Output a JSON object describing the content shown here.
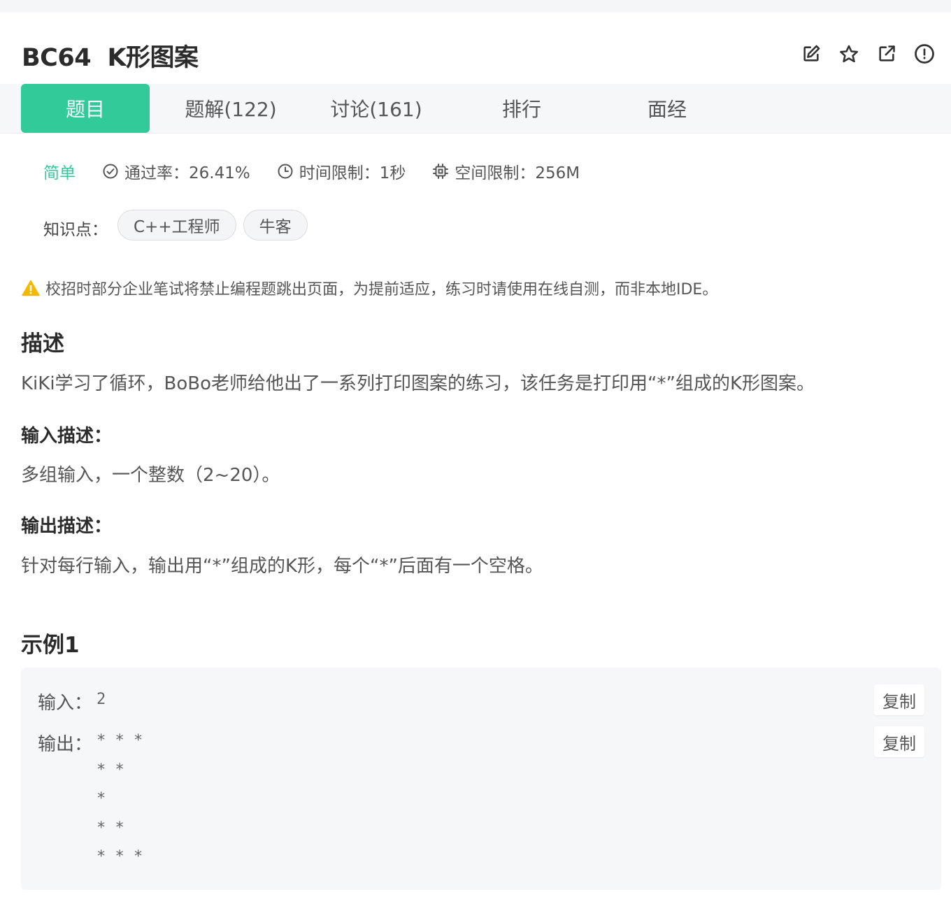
{
  "problem": {
    "title": "BC64  K形图案"
  },
  "tabs": [
    {
      "label": "题目",
      "active": true
    },
    {
      "label": "题解(122)",
      "active": false
    },
    {
      "label": "讨论(161)",
      "active": false
    },
    {
      "label": "排行",
      "active": false
    },
    {
      "label": "面经",
      "active": false
    }
  ],
  "meta": {
    "difficulty": "简单",
    "pass_rate": "通过率：26.41%",
    "time_limit": "时间限制：1秒",
    "memory_limit": "空间限制：256M"
  },
  "knowledge": {
    "label": "知识点：",
    "tags": [
      "C++工程师",
      "牛客"
    ]
  },
  "warning": "校招时部分企业笔试将禁止编程题跳出页面，为提前适应，练习时请使用在线自测，而非本地IDE。",
  "description": {
    "heading": "描述",
    "text": "KiKi学习了循环，BoBo老师给他出了一系列打印图案的练习，该任务是打印用“*”组成的K形图案。"
  },
  "input_desc": {
    "heading": "输入描述：",
    "text": "多组输入，一个整数（2~20）。"
  },
  "output_desc": {
    "heading": "输出描述：",
    "text": "针对每行输入，输出用“*”组成的K形，每个“*”后面有一个空格。"
  },
  "example": {
    "heading": "示例1",
    "input_label": "输入：",
    "input_value": "2",
    "output_label": "输出：",
    "output_value": "* * * \n* * \n* \n* * \n* * * ",
    "copy_label": "复制"
  },
  "colors": {
    "accent": "#32ca99",
    "warning": "#f5b800"
  },
  "icons": [
    "edit-icon",
    "star-icon",
    "share-icon",
    "report-icon",
    "check-circle-icon",
    "clock-icon",
    "chip-icon",
    "warning-icon"
  ]
}
